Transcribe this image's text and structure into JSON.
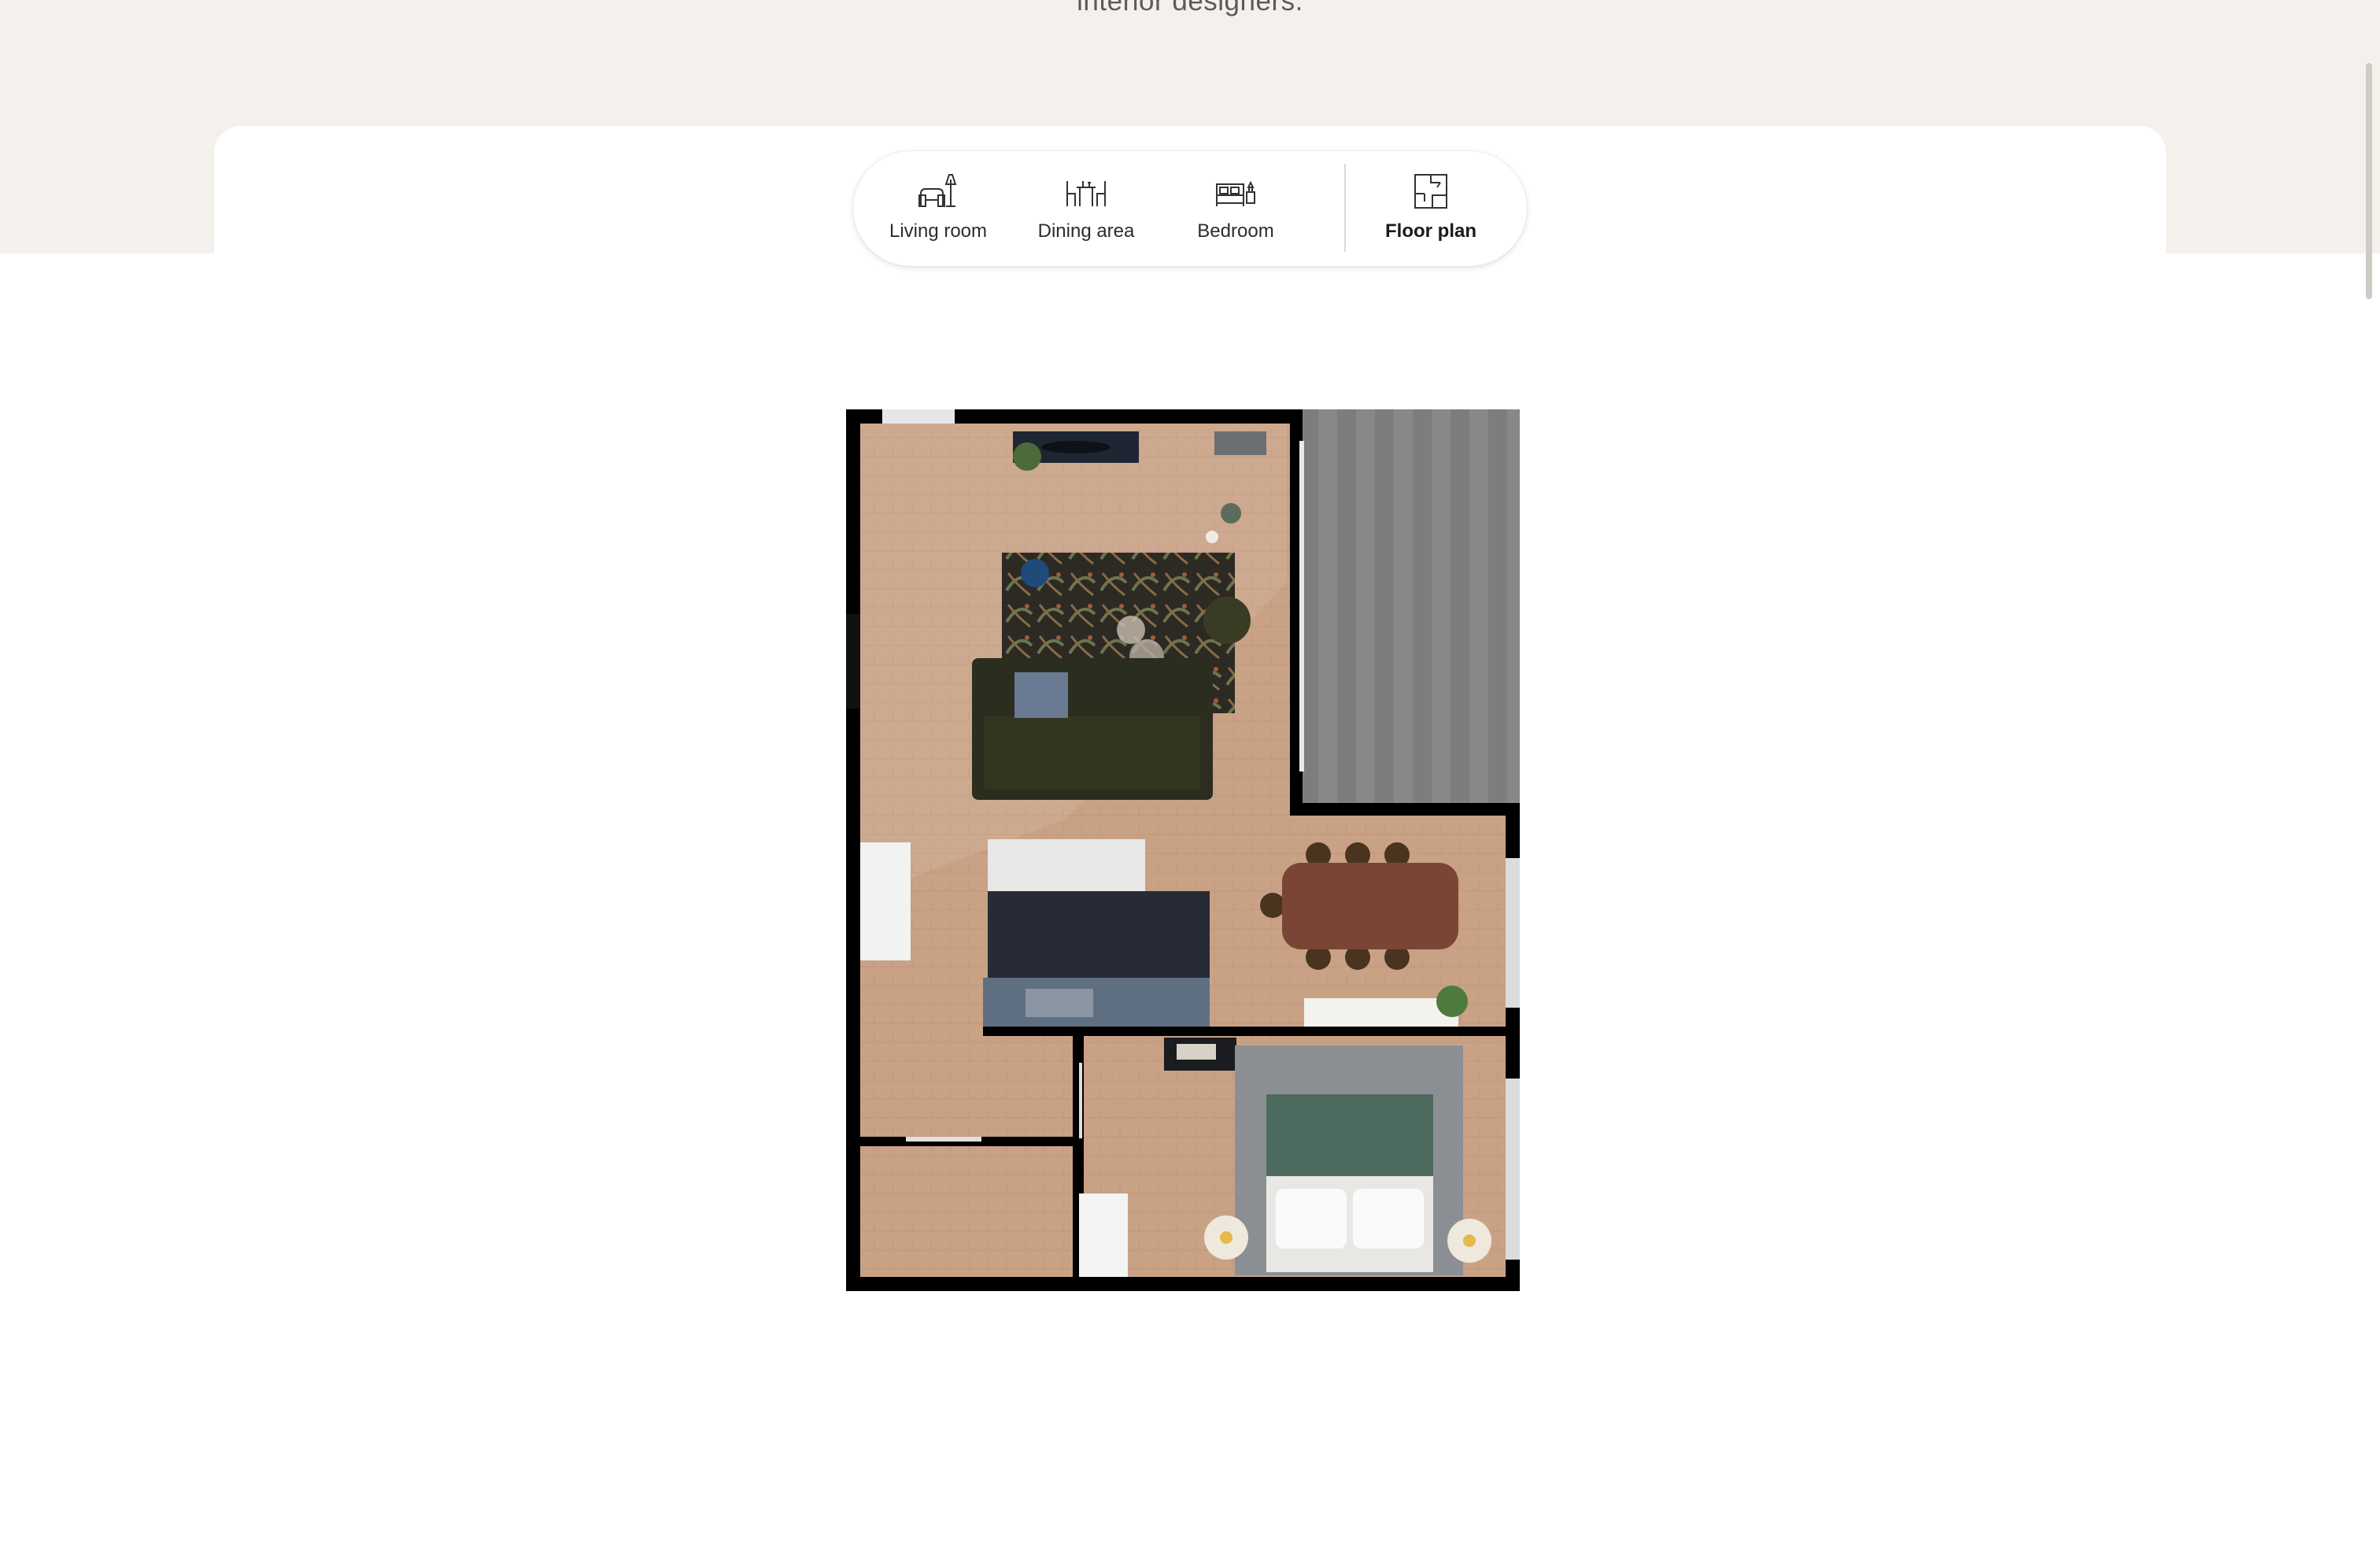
{
  "header": {
    "subtitle": "interior designers."
  },
  "tabs": [
    {
      "label": "Living room",
      "icon": "armchair-lamp-icon",
      "active": false
    },
    {
      "label": "Dining area",
      "icon": "dining-table-chairs-icon",
      "active": false
    },
    {
      "label": "Bedroom",
      "icon": "bed-icon",
      "active": false
    },
    {
      "label": "Floor plan",
      "icon": "floor-plan-icon",
      "active": true
    }
  ],
  "floor_plan": {
    "image": "top-down-apartment-floor-plan"
  },
  "colors": {
    "background_band": "#f4f1ec",
    "text_dark": "#2f2c29",
    "wall": "#000000",
    "floor_wood": "#c9a286",
    "balcony": "#8a8886"
  }
}
